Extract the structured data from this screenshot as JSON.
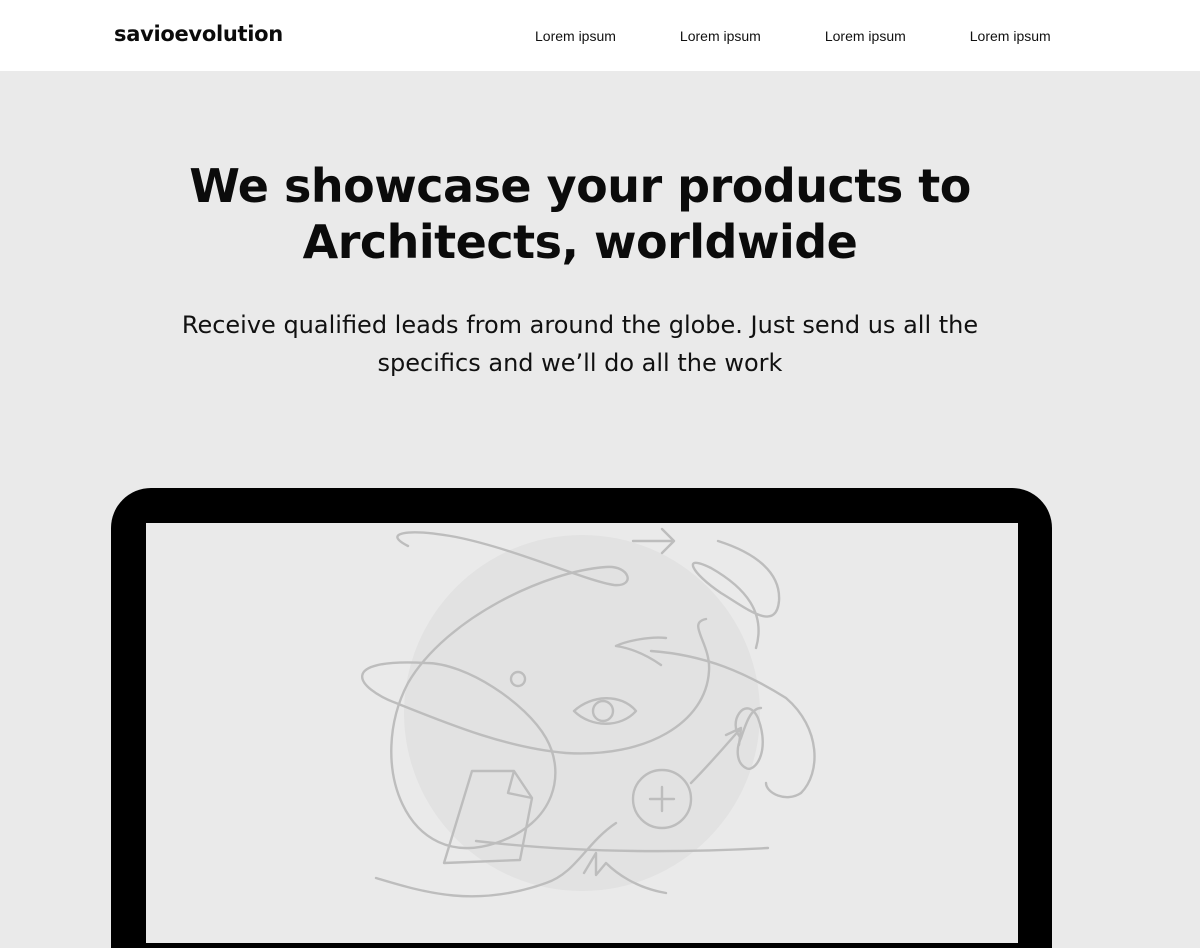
{
  "header": {
    "logo": "savioevolution",
    "nav": [
      "Lorem ipsum",
      "Lorem ipsum",
      "Lorem ipsum",
      "Lorem ipsum"
    ]
  },
  "hero": {
    "title": "We showcase your products to Architects, worldwide",
    "subtitle": "Receive qualified leads from around the globe. Just send us all the specifics and we’ll do all the work"
  },
  "device": {
    "illustration": "globe-doodle-illustration",
    "icons": [
      "arrow-right-icon",
      "eye-icon",
      "plus-circle-icon",
      "document-icon"
    ]
  },
  "colors": {
    "background": "#eaeaea",
    "header": "#ffffff",
    "text": "#0b0b0b",
    "device_frame": "#000000",
    "illustration_stroke": "#bdbdbd",
    "globe_fill": "#e2e2e2"
  }
}
